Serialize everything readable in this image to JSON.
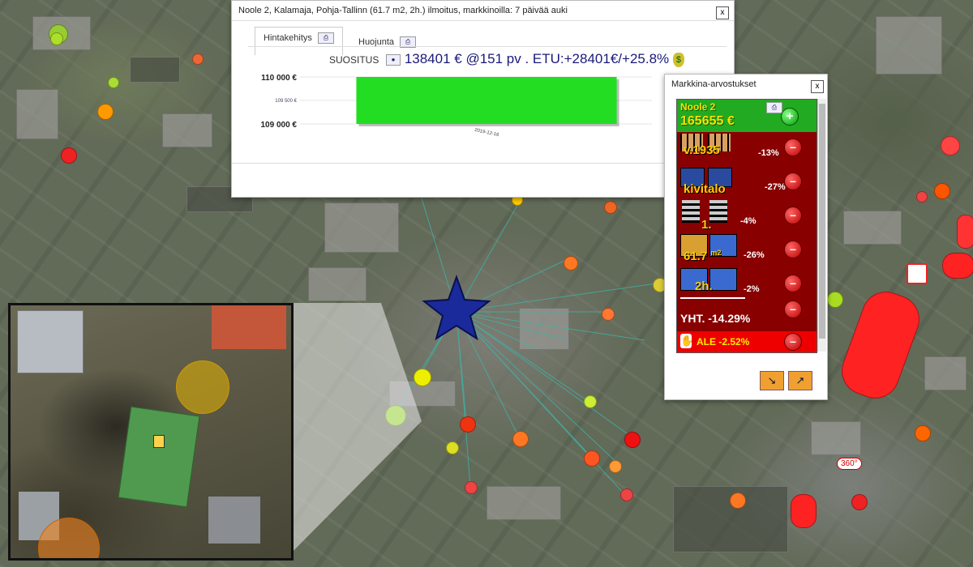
{
  "listing_window": {
    "title": "Noole 2, Kalamaja, Pohja-Tallinn (61.7 m2, 2h.) ilmoitus, markkinoilla: 7 päivää auki",
    "close_label": "x",
    "tabs": [
      {
        "label": "Hintakehitys"
      },
      {
        "label": "Huojunta"
      }
    ],
    "recommendation": {
      "label": "SUOSITUS",
      "text": "138401 € @151 pv . ETU:+28401€/+25.8%"
    },
    "chart_data": {
      "type": "bar",
      "categories": [
        "2019-12-16"
      ],
      "values": [
        110000
      ],
      "ylim": [
        109000,
        110000
      ],
      "yticks": [
        "110 000 €",
        "109 500 €",
        "109 000 €"
      ],
      "bar_color": "#22dd22"
    }
  },
  "valuation_window": {
    "title": "Markkina-arvostukset",
    "close_label": "x",
    "property_name": "Noole 2",
    "price": "165655 €",
    "rows": [
      {
        "value": "v.1935",
        "pct": "-13%",
        "icon": "brick-building-icon"
      },
      {
        "value": "kivitalo",
        "pct": "-27%",
        "icon": "stone-house-icon"
      },
      {
        "value": "1.",
        "pct": "-4%",
        "icon": "floor-icon"
      },
      {
        "value": "61.7",
        "unit": "m2",
        "pct": "-26%",
        "icon": "area-icon"
      },
      {
        "value": "2h.",
        "pct": "-2%",
        "icon": "rooms-icon"
      }
    ],
    "total": "YHT. -14.29%",
    "discount": "ALE -2.52%",
    "colors": {
      "panel": "#800000",
      "header": "#22aa22",
      "discount_bar": "#ee0000"
    }
  },
  "map": {
    "badge_360": "360°"
  }
}
